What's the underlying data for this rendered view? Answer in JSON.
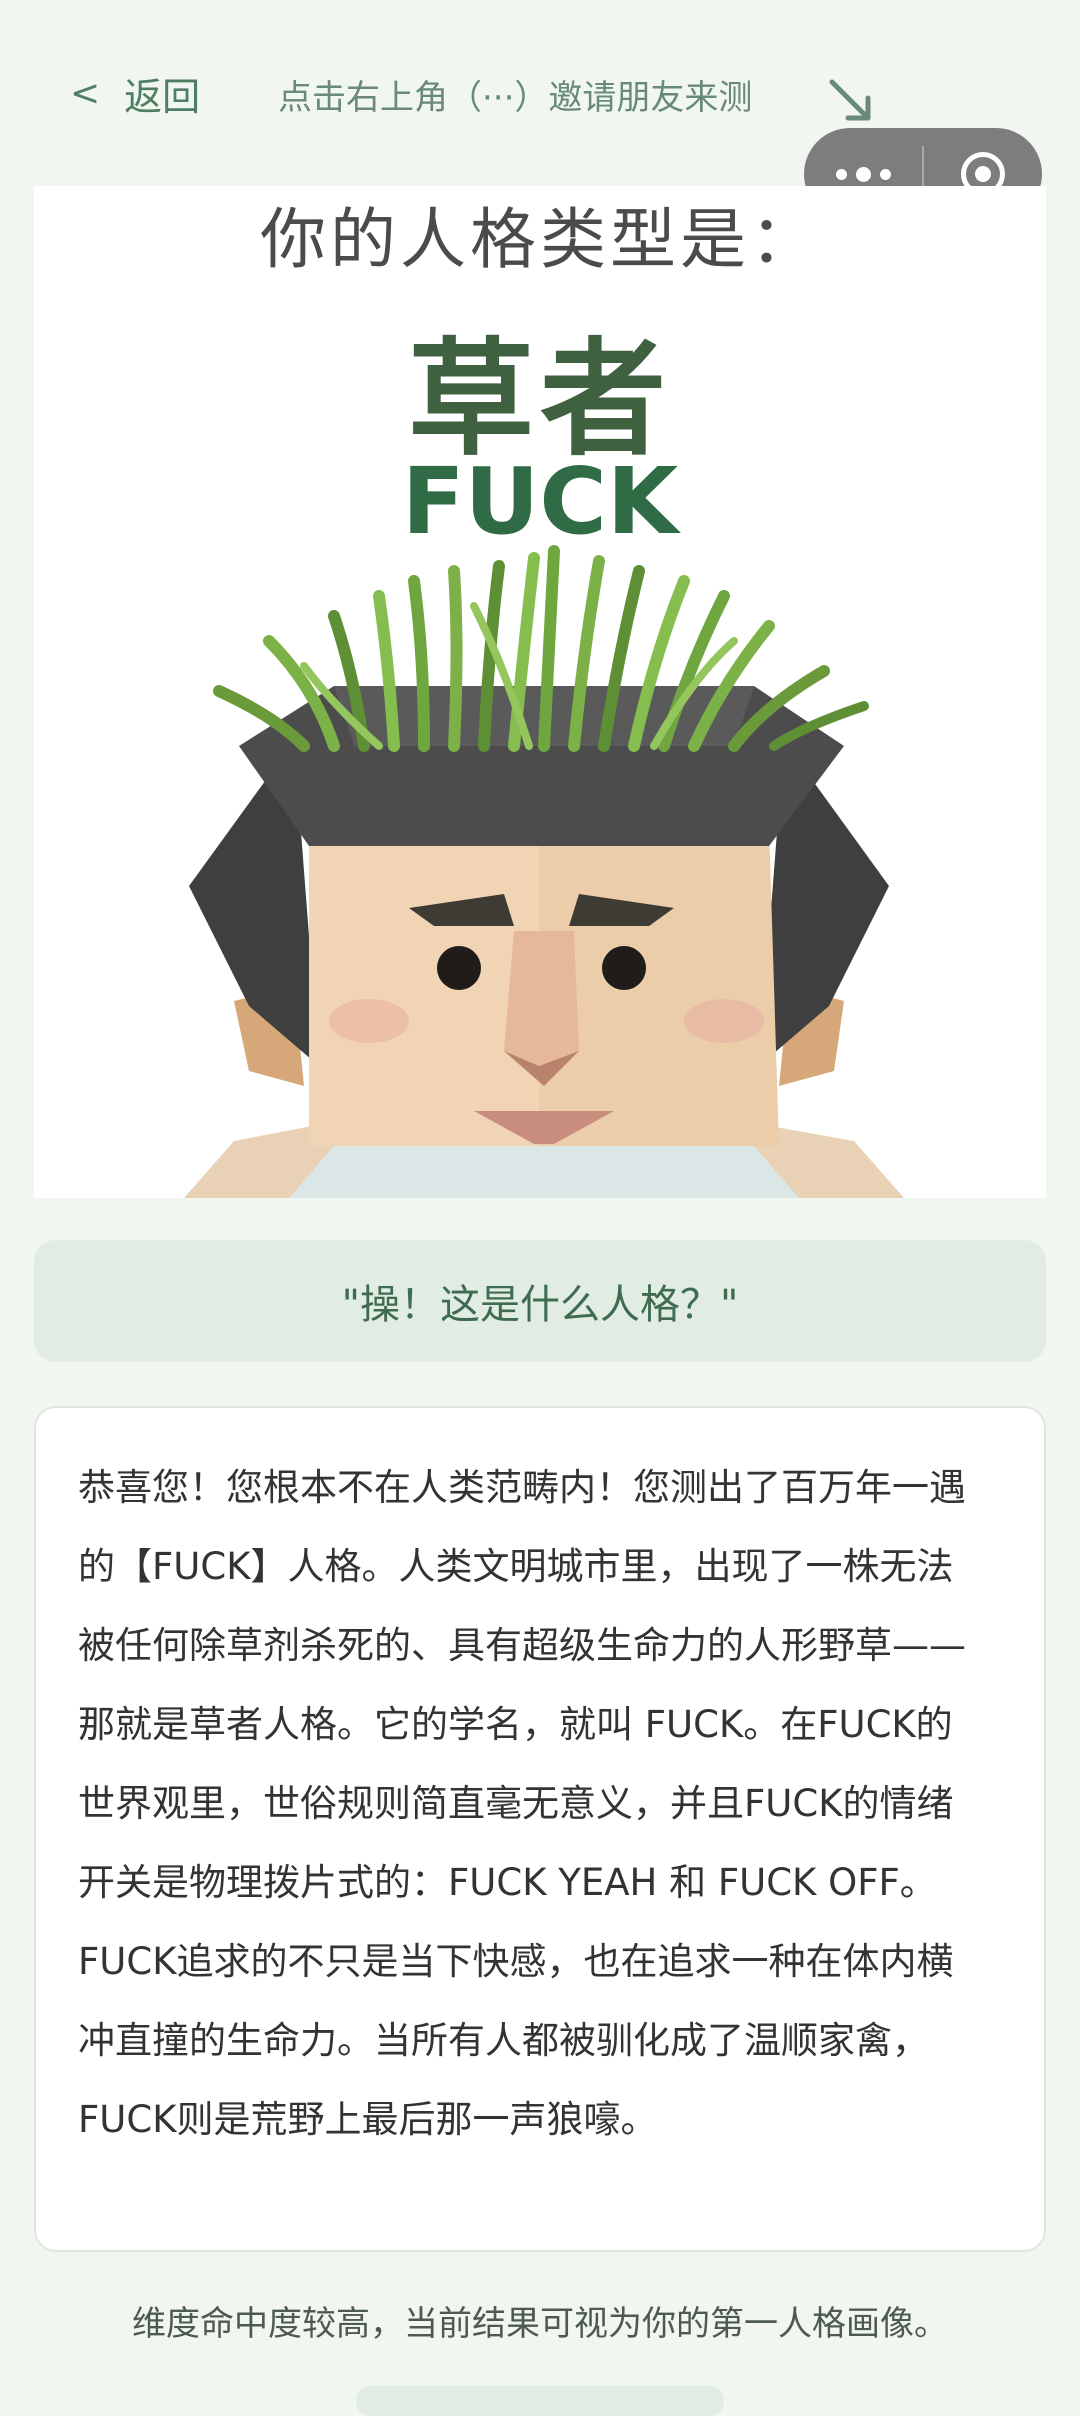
{
  "header": {
    "back_chevron": "<",
    "back_label": "返回",
    "hint": "点击右上角（···）邀请朋友来测",
    "hint_icon": "arrow-down-right-icon"
  },
  "capsule": {
    "more_icon": "more-dots-icon",
    "close_icon": "target-icon"
  },
  "poster": {
    "title": "你的人格类型是：",
    "type_name": "草者",
    "type_code": "FUCK"
  },
  "quote": "\"操！这是什么人格？\"",
  "description": "恭喜您！您根本不在人类范畴内！您测出了百万年一遇的【FUCK】人格。人类文明城市里，出现了一株无法被任何除草剂杀死的、具有超级生命力的人形野草——那就是草者人格。它的学名，就叫 FUCK。在FUCK的世界观里，世俗规则简直毫无意义，并且FUCK的情绪开关是物理拨片式的：FUCK YEAH 和 FUCK OFF。FUCK追求的不只是当下快感，也在追求一种在体内横冲直撞的生命力。当所有人都被驯化成了温顺家禽，FUCK则是荒野上最后那一声狼嚎。",
  "footer_note": "维度命中度较高，当前结果可视为你的第一人格画像。",
  "colors": {
    "accent": "#4f7f63",
    "card_bg": "#e1ece2",
    "page_bg": "#f1f6f0"
  }
}
